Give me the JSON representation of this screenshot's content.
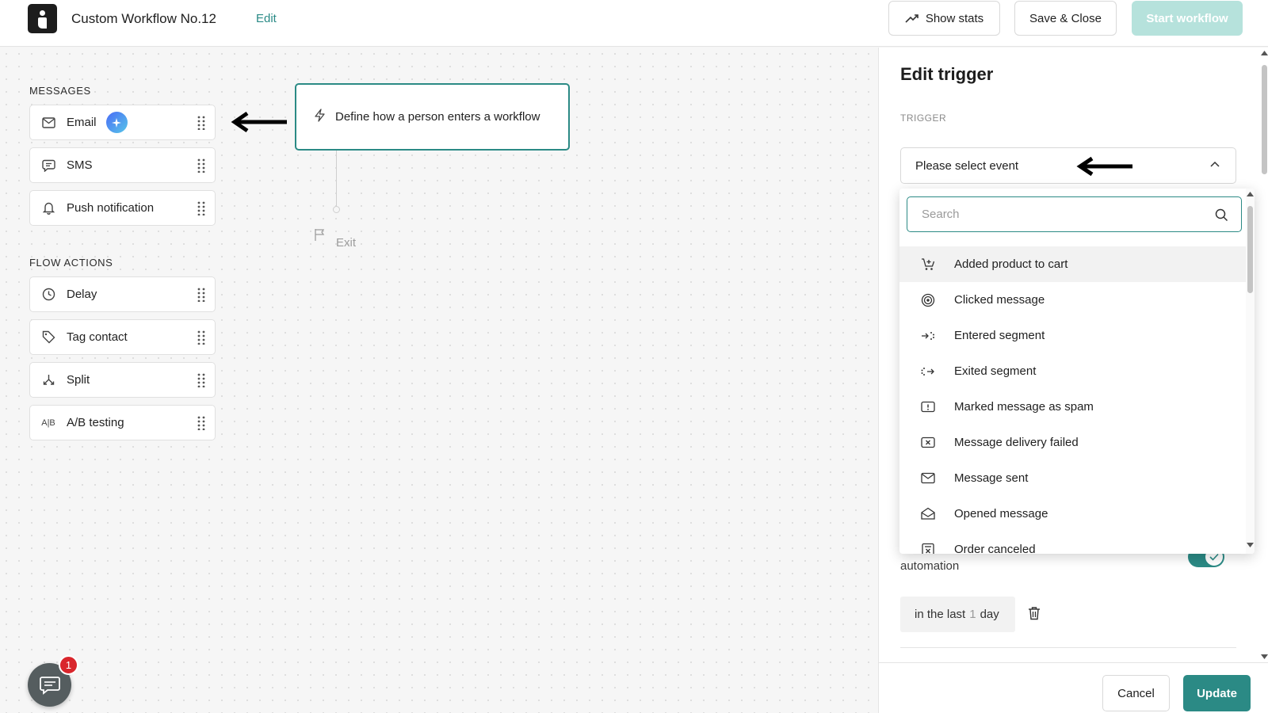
{
  "header": {
    "workflow_title": "Custom Workflow No.12",
    "edit_label": "Edit",
    "show_stats_label": "Show stats",
    "save_close_label": "Save & Close",
    "start_workflow_label": "Start workflow"
  },
  "palette": {
    "messages_heading": "MESSAGES",
    "messages": [
      {
        "label": "Email",
        "icon": "mail-icon"
      },
      {
        "label": "SMS",
        "icon": "chat-bubble-icon"
      },
      {
        "label": "Push notification",
        "icon": "bell-icon"
      }
    ],
    "flow_heading": "FLOW ACTIONS",
    "flow_actions": [
      {
        "label": "Delay",
        "icon": "clock-icon"
      },
      {
        "label": "Tag contact",
        "icon": "tag-icon"
      },
      {
        "label": "Split",
        "icon": "split-icon"
      },
      {
        "label": "A/B testing",
        "icon": "ab-icon",
        "icon_text": "A|B"
      }
    ]
  },
  "canvas": {
    "trigger_node_text": "Define how a person enters a workflow",
    "exit_label": "Exit"
  },
  "chat": {
    "badge_count": "1"
  },
  "panel": {
    "title": "Edit trigger",
    "trigger_label": "TRIGGER",
    "select_value": "Please select event",
    "automation_text": "automation",
    "toggle_on": true,
    "time": {
      "prefix": "in the last",
      "number": "1",
      "unit": "day"
    },
    "cancel_label": "Cancel",
    "update_label": "Update"
  },
  "dropdown": {
    "search_placeholder": "Search",
    "items": [
      {
        "label": "Added product to cart",
        "icon": "cart-icon"
      },
      {
        "label": "Clicked message",
        "icon": "target-icon"
      },
      {
        "label": "Entered segment",
        "icon": "enter-segment-icon"
      },
      {
        "label": "Exited segment",
        "icon": "exit-segment-icon"
      },
      {
        "label": "Marked message as spam",
        "icon": "spam-icon"
      },
      {
        "label": "Message delivery failed",
        "icon": "delivery-failed-icon"
      },
      {
        "label": "Message sent",
        "icon": "mail-icon"
      },
      {
        "label": "Opened message",
        "icon": "open-mail-icon"
      },
      {
        "label": "Order canceled",
        "icon": "order-canceled-icon"
      }
    ]
  },
  "colors": {
    "accent": "#2b8a85",
    "accent_light": "#b6e2dc",
    "badge_red": "#d9262c"
  }
}
